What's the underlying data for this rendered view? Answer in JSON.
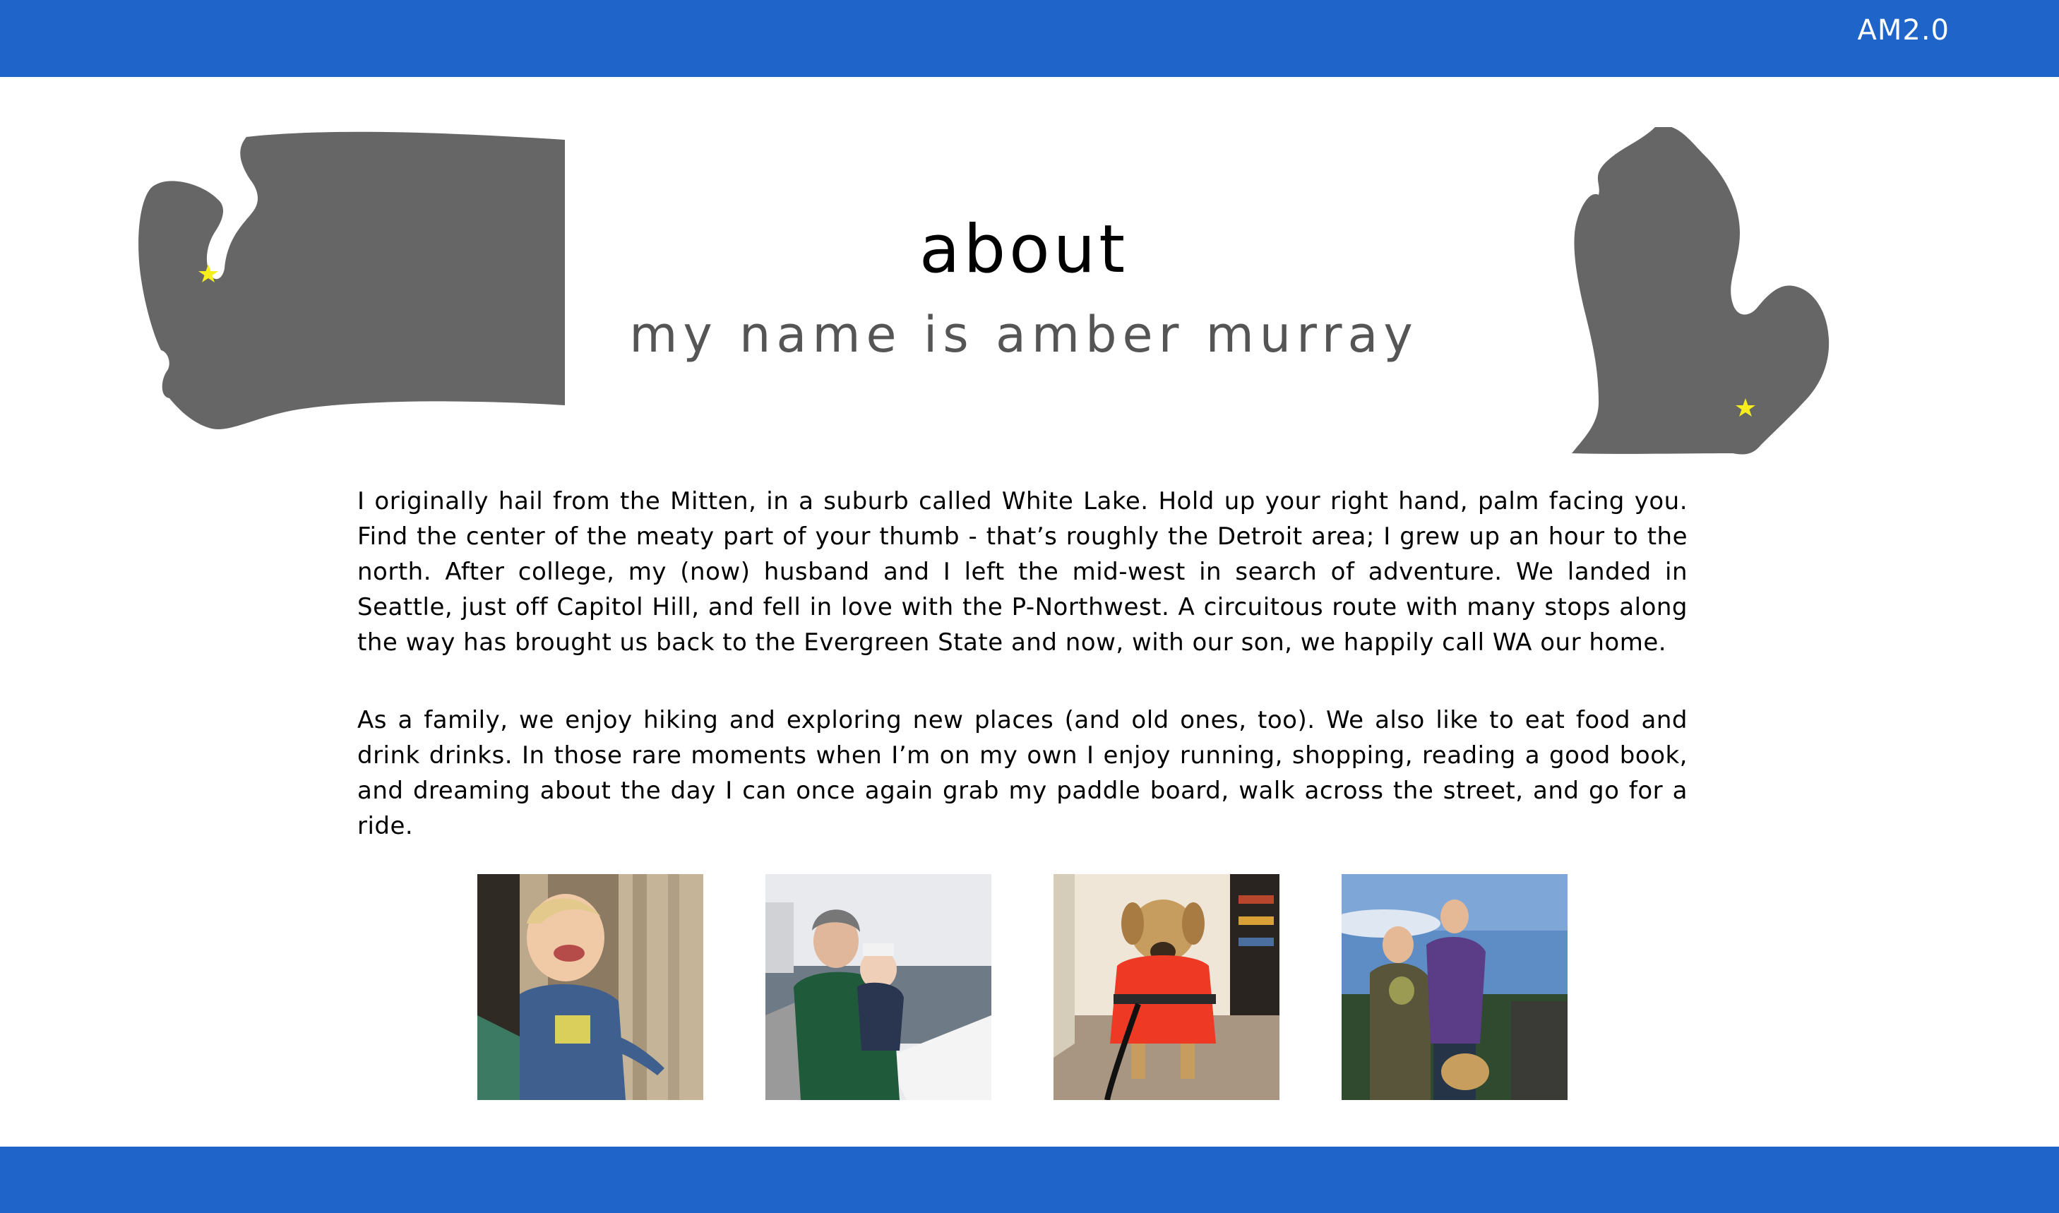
{
  "header": {
    "brand": "AM2.0",
    "brand_color": "#1f64c8"
  },
  "about": {
    "title": "about",
    "subtitle": "my name is amber murray"
  },
  "maps": [
    {
      "state": "Washington",
      "icon": "washington-state-map",
      "star_color": "#f5ee1c"
    },
    {
      "state": "Michigan",
      "icon": "michigan-state-map",
      "star_color": "#f5ee1c"
    }
  ],
  "paragraphs": [
    "I originally hail from the Mitten, in a suburb called White Lake. Hold up your right hand, palm facing you. Find the center of the meaty part of your thumb - that’s roughly the Detroit area; I grew up an hour to the north. After college, my (now) husband and I left the mid-west in search of adventure. We landed in Seattle, just off Capitol Hill, and fell in love with the P-Northwest. A circuitous route with many stops along the way has brought us back to the Evergreen State and now, with our son, we happily call WA our home.",
    "As a family, we enjoy hiking and exploring new places (and old ones, too). We also like to eat food and drink drinks. In those rare moments when I’m on my own I enjoy running, shopping, reading a good book, and dreaming about the day I can once again grab my paddle board, walk across the street, and go for a ride."
  ],
  "photos": [
    {
      "name": "photo-toddler"
    },
    {
      "name": "photo-dad-and-baby-ferry"
    },
    {
      "name": "photo-dog-life-vest"
    },
    {
      "name": "photo-family-hike"
    }
  ]
}
